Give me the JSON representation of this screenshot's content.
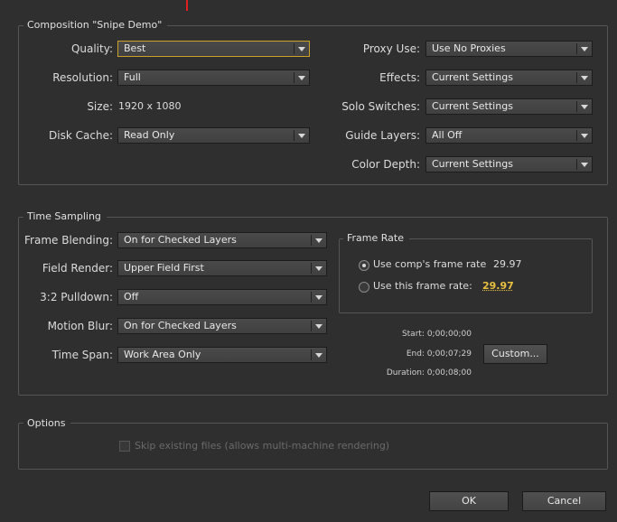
{
  "composition": {
    "title": "Composition \"Snipe Demo\"",
    "quality": {
      "label": "Quality:",
      "value": "Best"
    },
    "resolution": {
      "label": "Resolution:",
      "value": "Full"
    },
    "size": {
      "label": "Size:",
      "value": "1920 x 1080"
    },
    "disk_cache": {
      "label": "Disk Cache:",
      "value": "Read Only"
    },
    "proxy_use": {
      "label": "Proxy Use:",
      "value": "Use No Proxies"
    },
    "effects": {
      "label": "Effects:",
      "value": "Current Settings"
    },
    "solo_switches": {
      "label": "Solo Switches:",
      "value": "Current Settings"
    },
    "guide_layers": {
      "label": "Guide Layers:",
      "value": "All Off"
    },
    "color_depth": {
      "label": "Color Depth:",
      "value": "Current Settings"
    }
  },
  "time_sampling": {
    "title": "Time Sampling",
    "frame_blending": {
      "label": "Frame Blending:",
      "value": "On for Checked Layers"
    },
    "field_render": {
      "label": "Field Render:",
      "value": "Upper Field First"
    },
    "pulldown": {
      "label": "3:2 Pulldown:",
      "value": "Off"
    },
    "motion_blur": {
      "label": "Motion Blur:",
      "value": "On for Checked Layers"
    },
    "time_span": {
      "label": "Time Span:",
      "value": "Work Area Only"
    },
    "frame_rate": {
      "title": "Frame Rate",
      "use_comp_label": "Use comp's frame rate",
      "use_comp_value": "29.97",
      "use_this_label": "Use this frame rate:",
      "use_this_value": "29.97",
      "selected": "use_comp"
    },
    "start": "Start: 0;00;00;00",
    "end": "End: 0;00;07;29",
    "duration": "Duration: 0;00;08;00",
    "custom_button": "Custom..."
  },
  "options": {
    "title": "Options",
    "skip_existing": "Skip existing files (allows multi-machine rendering)"
  },
  "buttons": {
    "ok": "OK",
    "cancel": "Cancel"
  },
  "colors": {
    "background": "#2f2f2f",
    "focus_border": "#c9a227",
    "link": "#e8c040",
    "marker": "#e02020"
  }
}
